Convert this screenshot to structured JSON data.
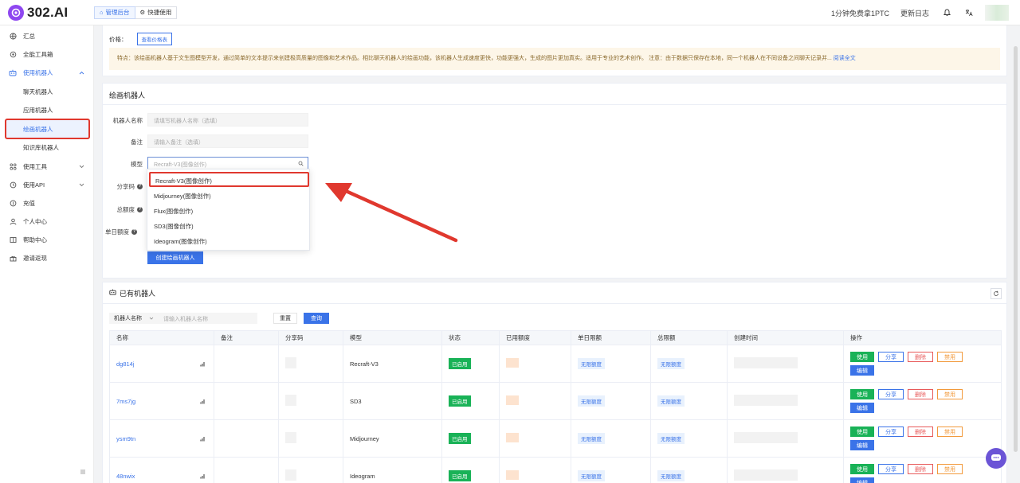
{
  "header": {
    "logo_text": "302.AI",
    "tabs": [
      {
        "label": "管理后台",
        "active": true
      },
      {
        "label": "快捷使用",
        "active": false
      }
    ],
    "promo_link": "1分钟免费拿1PTC",
    "changelog_link": "更新日志"
  },
  "sidebar": {
    "items": [
      {
        "label": "汇总",
        "icon": "globe-icon"
      },
      {
        "label": "全能工具箱",
        "icon": "toolbox-icon"
      },
      {
        "label": "使用机器人",
        "icon": "robot-icon"
      },
      {
        "label": "聊天机器人"
      },
      {
        "label": "应用机器人"
      },
      {
        "label": "绘画机器人"
      },
      {
        "label": "知识库机器人"
      },
      {
        "label": "使用工具",
        "icon": "grid-icon"
      },
      {
        "label": "使用API",
        "icon": "api-icon"
      },
      {
        "label": "充值",
        "icon": "coin-icon"
      },
      {
        "label": "个人中心",
        "icon": "user-icon"
      },
      {
        "label": "帮助中心",
        "icon": "book-icon"
      },
      {
        "label": "邀请返现",
        "icon": "gift-icon"
      }
    ]
  },
  "info_card": {
    "price_label": "价格：",
    "price_button": "查看价格表",
    "feature_text": "特点：该绘画机器人基于文生图模型开发，通过简单的文本提示来创建极高质量的图像和艺术作品。相比聊天机器人的绘画功能，该机器人生成速度更快，功能更强大，生成的图片更加真实。适用于专业的艺术创作。 注意：由于数据只保存在本地，同一个机器人在不同设备之间聊天记录并...",
    "read_more": "阅读全文"
  },
  "form": {
    "title": "绘画机器人",
    "name_label": "机器人名称",
    "name_placeholder": "请填写机器人名称（选填）",
    "note_label": "备注",
    "note_placeholder": "请输入备注（选填）",
    "model_label": "模型",
    "model_value": "Recraft-V3(图像创作)",
    "share_label": "分享码",
    "total_label": "总额度",
    "daily_label": "单日额度",
    "create_button": "创建绘画机器人",
    "model_options": [
      "Recraft-V3(图像创作)",
      "Midjourney(图像创作)",
      "Flux(图像创作)",
      "SD3(图像创作)",
      "Ideogram(图像创作)"
    ]
  },
  "robots": {
    "title": "已有机器人",
    "filter_field": "机器人名称",
    "filter_placeholder": "请输入机器人名称",
    "reset_button": "重置",
    "query_button": "查询",
    "columns": [
      "名称",
      "备注",
      "分享码",
      "模型",
      "状态",
      "已用额度",
      "单日限额",
      "总限额",
      "创建时间",
      "操作"
    ],
    "rows": [
      {
        "name": "dg814j",
        "model": "Recraft-V3",
        "status": "已启用",
        "daily": "无限额度",
        "total": "无限额度"
      },
      {
        "name": "7ms7jg",
        "model": "SD3",
        "status": "已启用",
        "daily": "无限额度",
        "total": "无限额度"
      },
      {
        "name": "ysm9tn",
        "model": "Midjourney",
        "status": "已启用",
        "daily": "无限额度",
        "total": "无限额度"
      },
      {
        "name": "48nwix",
        "model": "Ideogram",
        "status": "已启用",
        "daily": "无限额度",
        "total": "无限额度"
      }
    ],
    "actions": {
      "use": "使用",
      "share": "分享",
      "delete": "删除",
      "disable": "禁用",
      "edit": "编辑"
    }
  },
  "colors": {
    "accent": "#3a73e8",
    "brand": "#8e47f0",
    "success": "#19b257",
    "highlight": "#e0382e"
  }
}
